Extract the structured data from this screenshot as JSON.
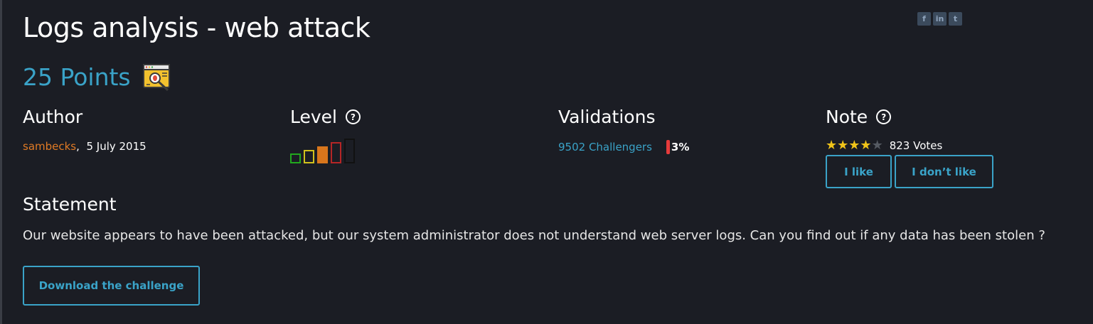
{
  "challenge": {
    "title": "Logs analysis - web attack",
    "points": "25 Points",
    "category_icon": "web-bug-icon"
  },
  "social": {
    "facebook": "f",
    "linkedin": "in",
    "twitter": "t"
  },
  "author": {
    "heading": "Author",
    "name": "sambecks",
    "separator": ",",
    "date": "5 July 2015"
  },
  "level": {
    "heading": "Level",
    "help_icon": "?",
    "bars": [
      {
        "color": "#22a81e",
        "filled": false
      },
      {
        "color": "#d1c11c",
        "filled": false
      },
      {
        "color": "#d8761c",
        "filled": true
      },
      {
        "color": "#b52626",
        "filled": false
      },
      {
        "color": "#111111",
        "filled": false
      }
    ],
    "current_level": 3
  },
  "validations": {
    "heading": "Validations",
    "challengers": "9502 Challengers",
    "percent": "3%"
  },
  "note": {
    "heading": "Note",
    "help_icon": "?",
    "rating_stars": 4,
    "max_stars": 5,
    "votes": "823 Votes",
    "like_label": "I like",
    "dislike_label": "I don’t like"
  },
  "statement": {
    "heading": "Statement",
    "text": "Our website appears to have been attacked, but our system administrator does not understand web server logs. Can you find out if any data has been stolen ?"
  },
  "download": {
    "label": "Download the challenge"
  },
  "colors": {
    "background": "#1b1d24",
    "accent": "#3aa3c8",
    "author": "#e07a24",
    "star": "#f0c419",
    "percent_bar": "#e63b3b"
  }
}
